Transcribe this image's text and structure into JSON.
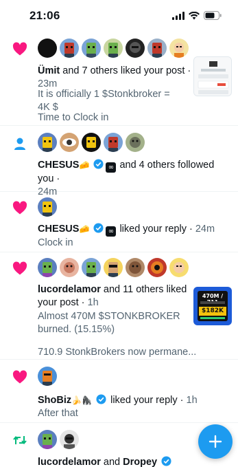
{
  "status_bar": {
    "time": "21:06"
  },
  "notifications": [
    {
      "type": "like",
      "actor": "Ümit",
      "action_text": "and 7 others liked your post ·",
      "time": "23m",
      "preview": "It is officially 1 $Stonkbroker = 4K $",
      "extra": "Time to Clock in"
    },
    {
      "type": "follow",
      "actor": "CHESUS",
      "actor_emoji": "🧀",
      "action_text": "and 4 others followed you ·",
      "time": "24m"
    },
    {
      "type": "like",
      "actor": "CHESUS",
      "actor_emoji": "🧀",
      "action_text": "liked your reply ·",
      "time": "24m",
      "preview": "Clock in"
    },
    {
      "type": "like",
      "actor": "lucordelamor",
      "action_text": "and 11 others liked",
      "action_text_2": "your post ·",
      "time": "1h",
      "preview_line1": "Almost 470M $STONKBROKER",
      "preview_line2": "burned. (15.15%)",
      "extra": "710.9 StonkBrokers now permane...",
      "thumbnail": {
        "top_text": "470M / 711",
        "mid_text": "$182K"
      }
    },
    {
      "type": "like",
      "actor": "ShoBiz",
      "actor_emoji": "🍌🦍",
      "action_text": "liked your reply ·",
      "time": "1h",
      "preview": "After that"
    },
    {
      "type": "retweet",
      "actor": "lucordelamor",
      "action_text": "and",
      "actor_2": "Dropey"
    }
  ],
  "colors": {
    "like": "#f91880",
    "follow": "#1d9bf0",
    "retweet": "#00ba7c",
    "verified": "#1d9bf0",
    "fab": "#1d9bf0"
  },
  "icons": {
    "like": "heart-icon",
    "follow": "person-icon",
    "retweet": "retweet-icon",
    "fab": "plus-icon"
  }
}
